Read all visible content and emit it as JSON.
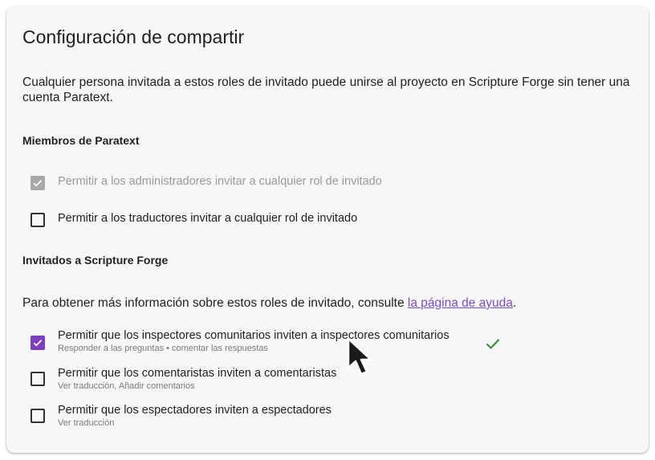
{
  "title": "Configuración de compartir",
  "intro": "Cualquier persona invitada a estos roles de invitado puede unirse al proyecto en Scripture Forge sin tener una cuenta Paratext.",
  "paratext_section": {
    "heading": "Miembros de Paratext",
    "options": [
      {
        "label": "Permitir a los administradores invitar a cualquier rol de invitado",
        "checked": true,
        "disabled": true
      },
      {
        "label": "Permitir a los traductores invitar a cualquier rol de invitado",
        "checked": false,
        "disabled": false
      }
    ]
  },
  "guests_section": {
    "heading": "Invitados a Scripture Forge",
    "help_prefix": "Para obtener más información sobre estos roles de invitado, consulte ",
    "help_link": "la página de ayuda",
    "help_suffix": ".",
    "options": [
      {
        "label": "Permitir que los inspectores comunitarios inviten a inspectores comunitarios",
        "sub": "Responder a las preguntas • comentar las respuestas",
        "checked": true,
        "saved": true
      },
      {
        "label": "Permitir que los comentaristas inviten a comentaristas",
        "sub": "Ver traducción, Añadir comentarios",
        "checked": false
      },
      {
        "label": "Permitir que los espectadores inviten a espectadores",
        "sub": "Ver traducción",
        "checked": false
      }
    ]
  },
  "colors": {
    "accent": "#7b3fbf",
    "link": "#7a4ec8",
    "saved_check": "#2e8b2e",
    "disabled": "#a9a9a9"
  },
  "icons": {
    "checkbox_check": "check-icon",
    "saved_indicator": "checkmark-icon",
    "pointer": "mouse-cursor-icon"
  }
}
